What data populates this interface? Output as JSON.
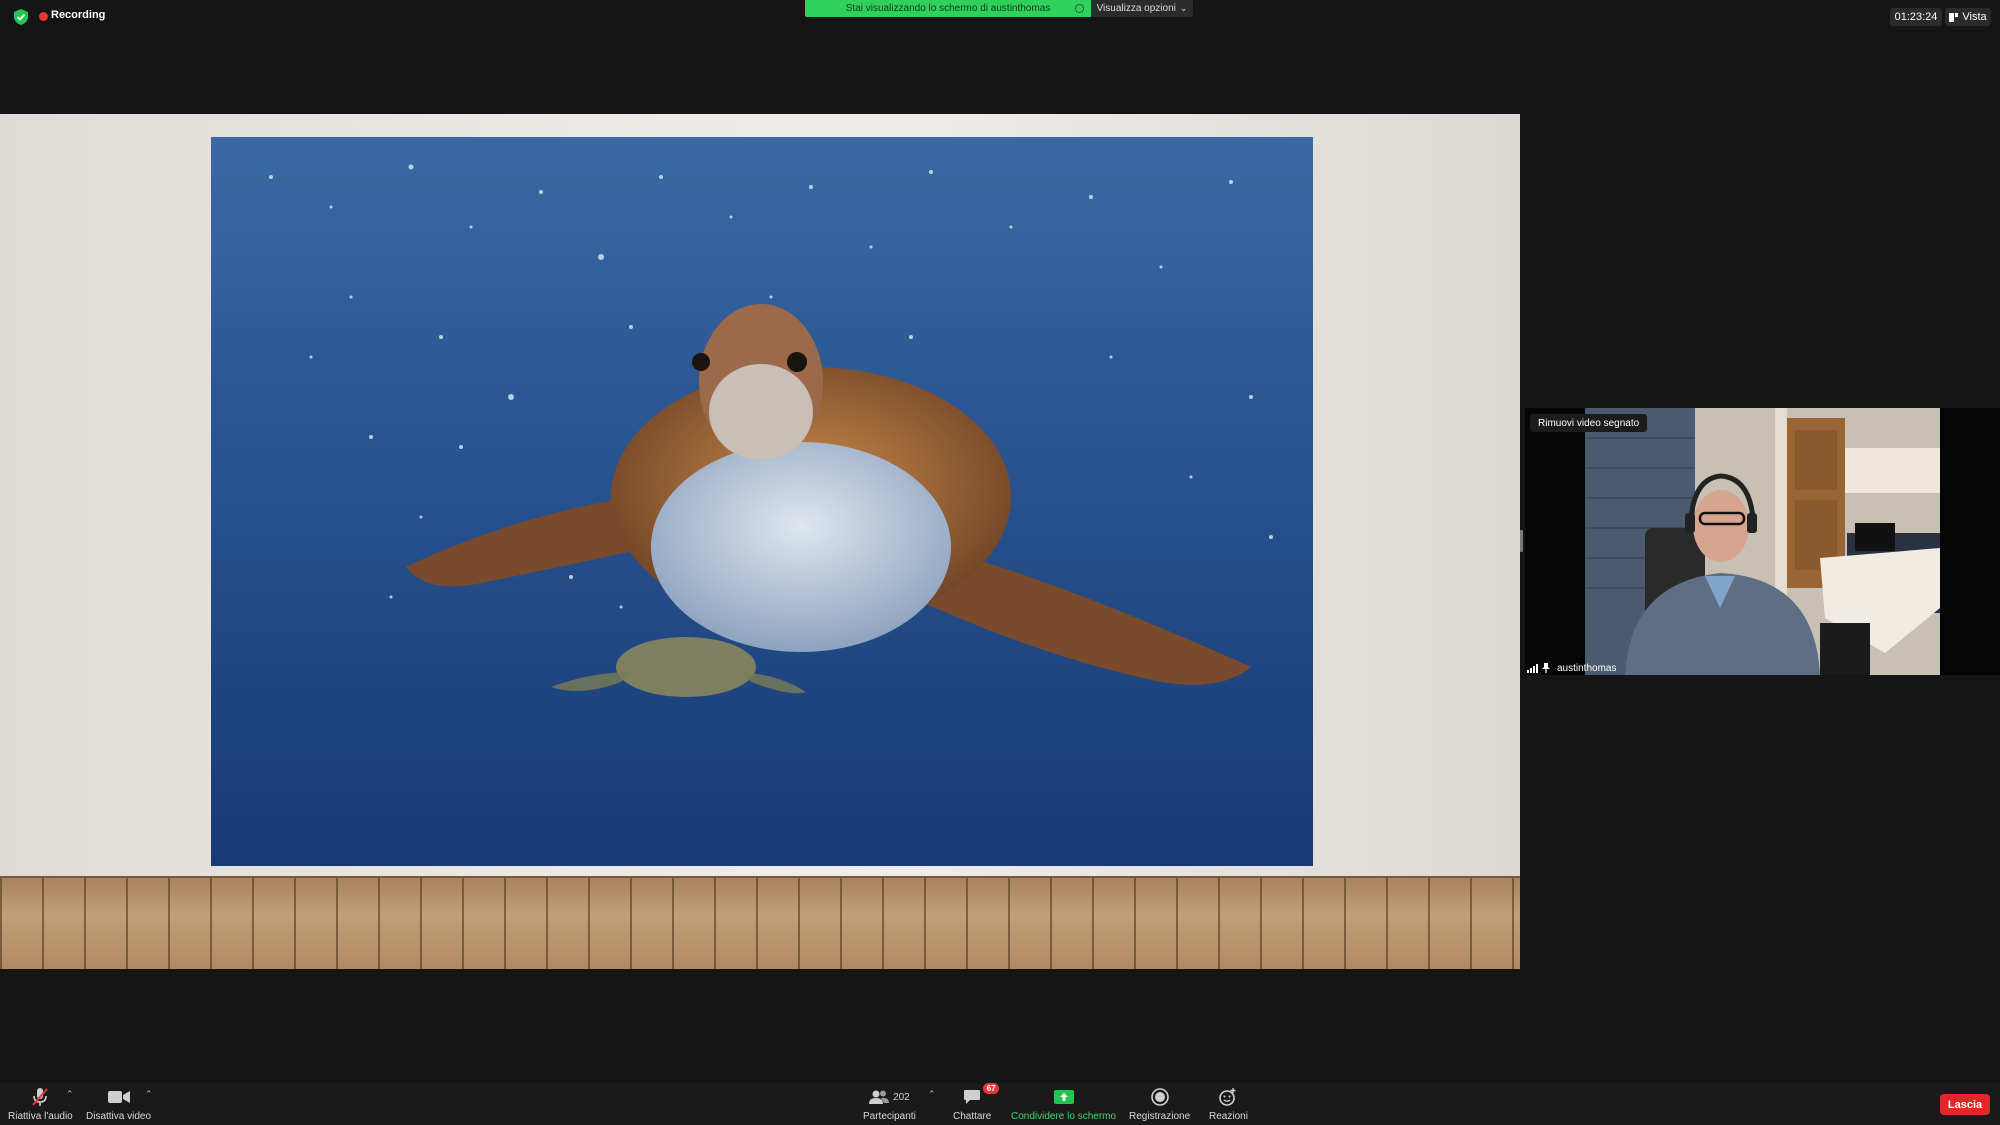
{
  "top_bar": {
    "recording_label": "Recording",
    "share_banner_text": "Stai visualizzando lo schermo di austinthomas",
    "view_options_label": "Visualizza opzioni",
    "elapsed_time": "01:23:24",
    "view_label": "Vista"
  },
  "video_tile": {
    "tooltip": "Rimuovi video segnato",
    "participant_name": "austinthomas"
  },
  "toolbar": {
    "unmute_label": "Riattiva l'audio",
    "stop_video_label": "Disattiva video",
    "participants_label": "Partecipanti",
    "participants_count": "202",
    "chat_label": "Chattare",
    "chat_badge": "67",
    "share_screen_label": "Condividere lo schermo",
    "recording_label": "Registrazione",
    "reactions_label": "Reazioni",
    "leave_label": "Lascia"
  },
  "icons": {
    "shield": "shield-check-icon",
    "record": "record-dot-icon",
    "chevron": "chevron-down-icon",
    "vista": "view-icon",
    "mic": "mic-muted-icon",
    "camera": "video-camera-icon",
    "participants": "participants-icon",
    "chat": "chat-icon",
    "share": "share-screen-icon",
    "recording": "recording-icon",
    "reactions": "reactions-icon",
    "signal": "signal-icon",
    "pin": "pin-icon"
  },
  "colors": {
    "share_banner": "#2fd15b",
    "leave_button": "#e02828",
    "recording_dot": "#e53935",
    "share_label": "#3bd96b"
  }
}
